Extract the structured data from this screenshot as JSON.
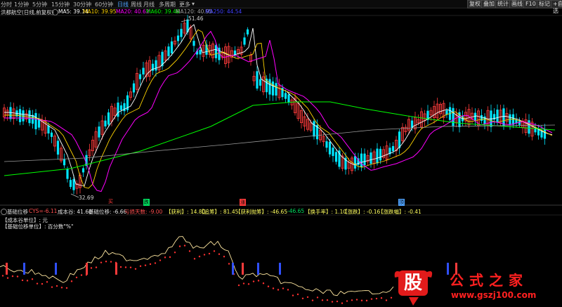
{
  "toolbar": {
    "tabs": [
      {
        "label": "分时",
        "active": false
      },
      {
        "label": "1分钟",
        "active": false
      },
      {
        "label": "5分钟",
        "active": false
      },
      {
        "label": "15分钟",
        "active": false
      },
      {
        "label": "30分钟",
        "active": false
      },
      {
        "label": "60分钟",
        "active": false
      },
      {
        "label": "日线",
        "active": true
      },
      {
        "label": "周线",
        "active": false
      },
      {
        "label": "月线",
        "active": false
      },
      {
        "label": "多周期",
        "active": false
      },
      {
        "label": "更多",
        "active": false
      }
    ],
    "more_arrow": "▾",
    "right_buttons": [
      "复权",
      "叠加",
      "统计",
      "画线",
      "F10",
      "标记",
      "+自选",
      "返回"
    ]
  },
  "ma_line": {
    "title": "洪都航空(日线,前复权)",
    "ma5": "MA5: 39.14",
    "ma10": "MA10: 39.95",
    "ma20": "MA20: 40.62",
    "ma60": "MA60: 39.46",
    "ma120": "MA120: 40.95",
    "ma250": "MA250: 44.54"
  },
  "price_labels": {
    "high": "51.46",
    "low": "32.69"
  },
  "signals": {
    "s1": "买",
    "s2": "跌",
    "s3": "涨",
    "s4": "顶"
  },
  "indicator": {
    "name": "基础位移",
    "cys_label": "CYS=",
    "cys_value": "-6.11",
    "cost_valley": "成本谷: 41.60",
    "base_shift": "基础位移: -6.66",
    "loss_days": "亏损天数: -9.00",
    "profit": "【获利】: 14.80",
    "hype": "【追筹】: 81.45",
    "profit_loss": "【获利抛筹】: -46.65",
    "profit_loss_value": "-46.65",
    "turnover": "【换手率】: 1.10",
    "rise_fall": "【涨跌】: -0.16",
    "range": "【涨跌幅】: -0.41"
  },
  "notes": {
    "line1": "【成本谷单位】: 元",
    "line2": "【基础位移单位】: 百分数\"%\""
  },
  "watermark": {
    "gu": "股",
    "title": "公式之家",
    "url": "www.gszj100.com"
  },
  "colors": {
    "up": "#ff3b3b",
    "down": "#00e6ff",
    "ma5": "#ffffff",
    "ma10": "#ffd400",
    "ma20": "#ff00ff",
    "ma60": "#00ff00",
    "ma120": "#9a9a9a",
    "ma250": "#4040ff"
  }
}
